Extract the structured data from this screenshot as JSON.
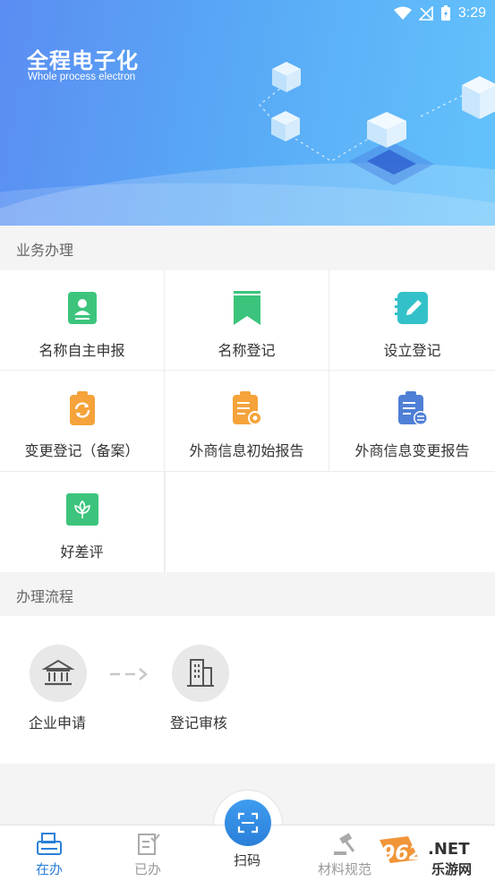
{
  "status_bar": {
    "time": "3:29"
  },
  "banner": {
    "title": "全程电子化",
    "subtitle": "Whole process electron"
  },
  "services": {
    "header": "业务办理",
    "items": [
      {
        "label": "名称自主申报",
        "icon": "contact-card-icon",
        "color": "#3cc47c"
      },
      {
        "label": "名称登记",
        "icon": "bookmark-icon",
        "color": "#3cc47c"
      },
      {
        "label": "设立登记",
        "icon": "edit-note-icon",
        "color": "#33c1c9"
      },
      {
        "label": "变更登记（备案）",
        "icon": "clipboard-refresh-icon",
        "color": "#f5a33a"
      },
      {
        "label": "外商信息初始报告",
        "icon": "clipboard-report-icon",
        "color": "#f5a33a"
      },
      {
        "label": "外商信息变更报告",
        "icon": "clipboard-exchange-icon",
        "color": "#4f7fd6"
      },
      {
        "label": "好差评",
        "icon": "flower-icon",
        "color": "#3cc47c"
      }
    ]
  },
  "process": {
    "header": "办理流程",
    "steps": [
      {
        "label": "企业申请",
        "icon": "bank-icon"
      },
      {
        "label": "登记审核",
        "icon": "building-icon"
      }
    ]
  },
  "bottom_nav": {
    "items": [
      {
        "label": "在办",
        "icon": "in-progress-icon",
        "active": true
      },
      {
        "label": "已办",
        "icon": "done-doc-icon",
        "active": false
      },
      {
        "label": "扫码",
        "icon": "scan-icon",
        "active": false
      },
      {
        "label": "材料规范",
        "icon": "gavel-icon",
        "active": false
      }
    ]
  },
  "watermark": {
    "text1": "962",
    "text2": ".NET",
    "text3": "乐游网"
  },
  "colors": {
    "accent": "#2a7fd8",
    "banner_start": "#5b8df2",
    "banner_end": "#63c3fb"
  }
}
